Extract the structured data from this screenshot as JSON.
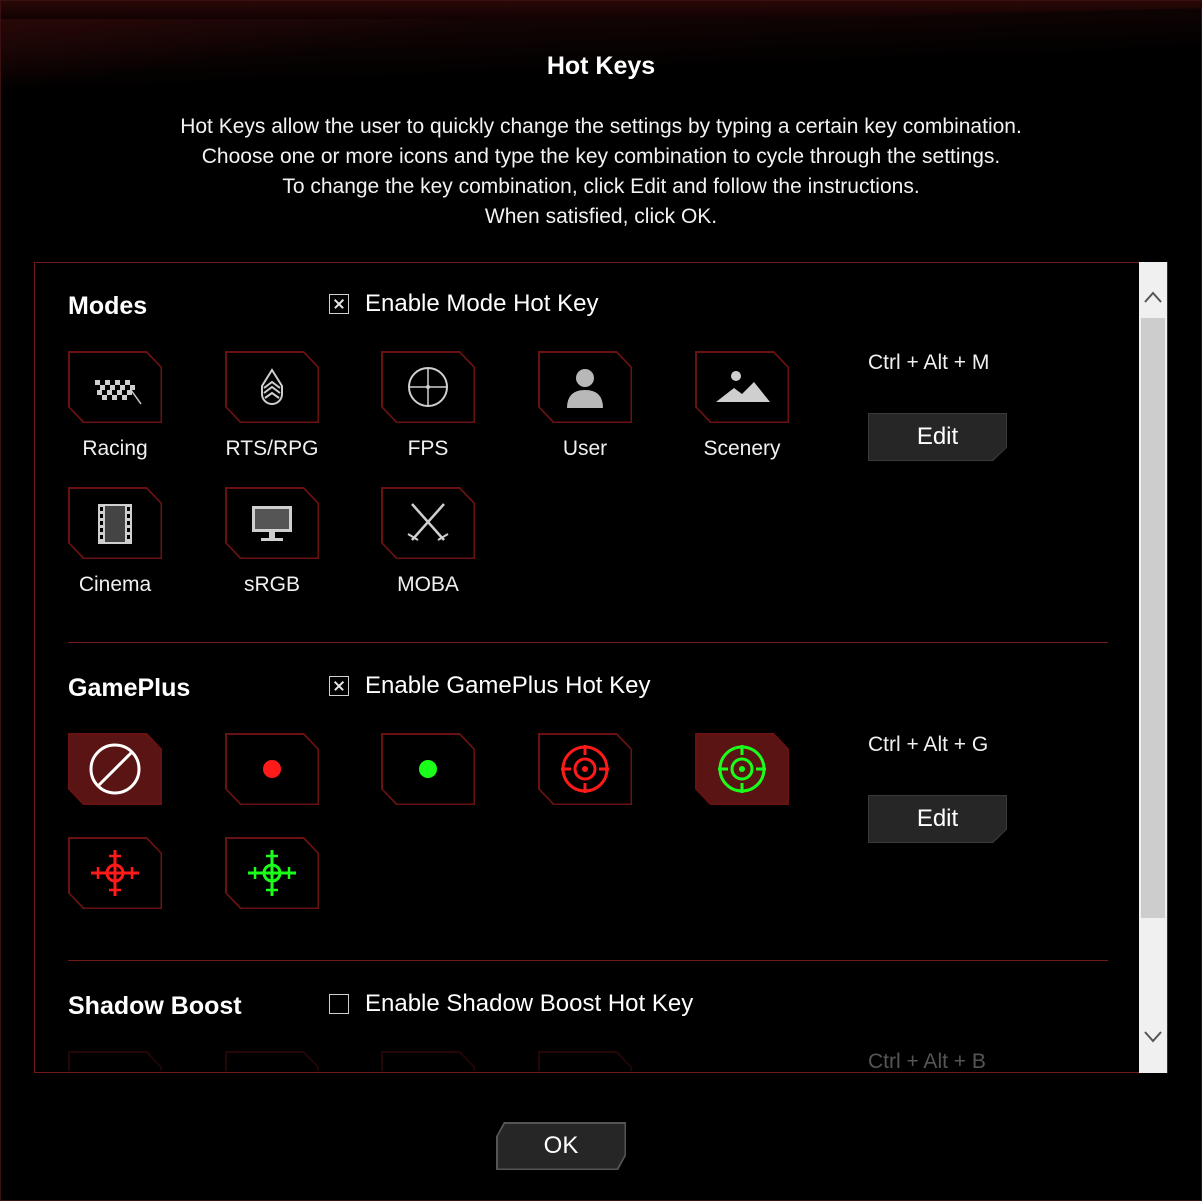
{
  "dialog": {
    "title": "Hot Keys",
    "description": [
      "Hot Keys allow the user to quickly change the settings by typing a certain key combination.",
      "Choose one or more icons and type the key combination to cycle through the settings.",
      "To change the key combination, click Edit and follow the instructions.",
      "When satisfied, click OK."
    ],
    "ok_label": "OK"
  },
  "modes": {
    "title": "Modes",
    "enable_label": "Enable Mode Hot Key",
    "enabled": true,
    "hotkey": "Ctrl + Alt + M",
    "edit_label": "Edit",
    "items": [
      {
        "label": "Racing",
        "icon": "racing-flag-icon"
      },
      {
        "label": "RTS/RPG",
        "icon": "rank-chevron-icon"
      },
      {
        "label": "FPS",
        "icon": "crosshair-icon"
      },
      {
        "label": "User",
        "icon": "user-icon"
      },
      {
        "label": "Scenery",
        "icon": "scenery-icon"
      },
      {
        "label": "Cinema",
        "icon": "film-icon"
      },
      {
        "label": "sRGB",
        "icon": "monitor-icon"
      },
      {
        "label": "MOBA",
        "icon": "crossed-swords-icon"
      }
    ]
  },
  "gameplus": {
    "title": "GamePlus",
    "enable_label": "Enable GamePlus Hot Key",
    "enabled": true,
    "hotkey": "Ctrl + Alt + G",
    "edit_label": "Edit",
    "items": [
      {
        "icon": "disabled-icon",
        "active": true
      },
      {
        "icon": "red-dot-icon",
        "active": false
      },
      {
        "icon": "green-dot-icon",
        "active": false
      },
      {
        "icon": "red-target-icon",
        "active": false
      },
      {
        "icon": "green-target-icon",
        "active": true
      },
      {
        "icon": "red-crosshair-icon",
        "active": false
      },
      {
        "icon": "green-crosshair-icon",
        "active": false
      }
    ]
  },
  "shadow_boost": {
    "title": "Shadow Boost",
    "enable_label": "Enable Shadow Boost Hot Key",
    "enabled": false,
    "hotkey": "Ctrl + Alt + B"
  },
  "colors": {
    "accent": "#6a1212",
    "active_tile": "#5a1414",
    "red": "#ff1a1a",
    "green": "#1aff1a"
  }
}
